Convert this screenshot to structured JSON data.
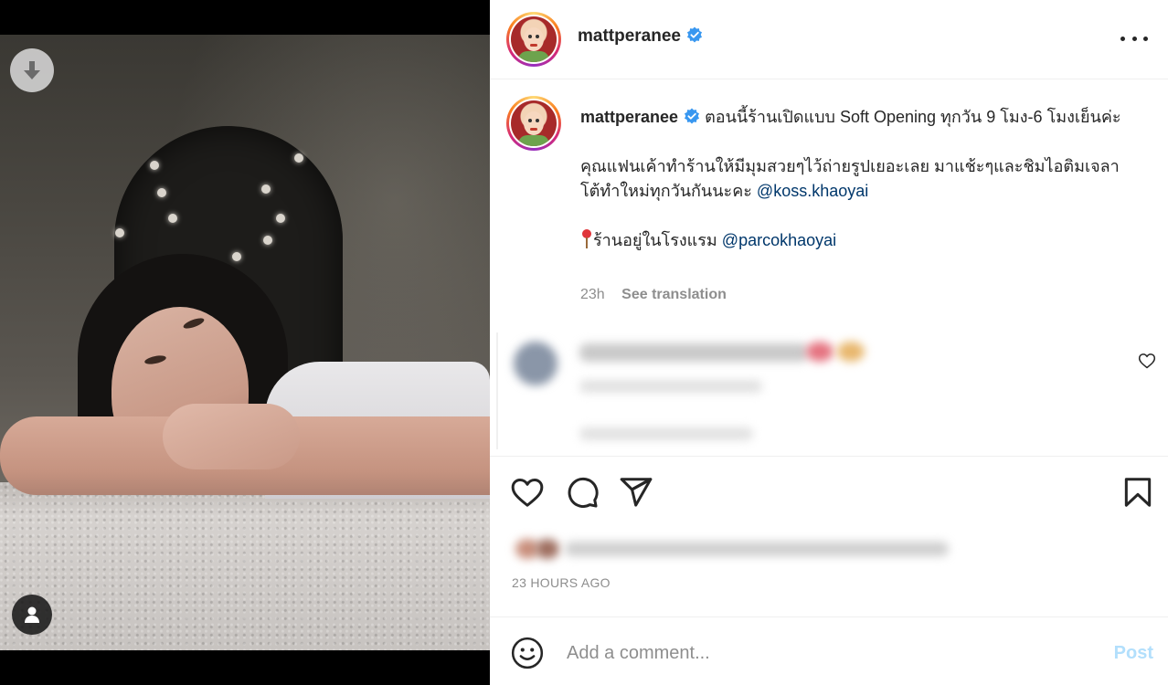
{
  "post": {
    "username": "mattperanee",
    "verified": true,
    "caption": {
      "line1": "ตอนนี้ร้านเปิดแบบ Soft Opening ทุกวัน 9 โมง-6 โมงเย็นค่ะ",
      "para2_text": "คุณแฟนเค้าทำร้านให้มีมุมสวยๆไว้ถ่ายรูปเยอะเลย มาแช้ะๆและชิมไอติมเจลาโต้ทำใหม่ทุกวันกันนะคะ ",
      "para2_mention": "@koss.khaoyai",
      "para3_text": "ร้านอยู่ในโรงแรม ",
      "para3_mention": "@parcokhaoyai"
    },
    "relative_time": "23h",
    "see_translation": "See translation",
    "timestamp": "23 HOURS AGO"
  },
  "composer": {
    "placeholder": "Add a comment...",
    "post_label": "Post"
  },
  "icons": {
    "download": "arrow-down-circle-icon",
    "user_tags": "user-icon",
    "more": "more-horizontal-icon",
    "verified": "verified-badge-icon",
    "like": "heart-icon",
    "comment": "comment-bubble-icon",
    "share": "paper-plane-icon",
    "save": "bookmark-icon",
    "emoji": "smiley-icon",
    "pin": "round-pushpin-icon"
  },
  "colors": {
    "link": "#00376b",
    "verified": "#3897f0",
    "post_button_disabled": "#b2dffc",
    "secondary_text": "#8e8e8e"
  }
}
